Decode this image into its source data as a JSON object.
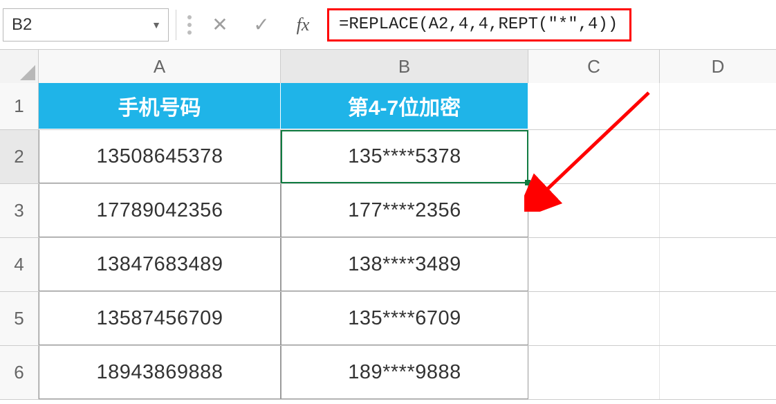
{
  "name_box": {
    "value": "B2"
  },
  "formula_bar": {
    "cancel_icon": "✕",
    "accept_icon": "✓",
    "fx_label": "fx",
    "formula": "=REPLACE(A2,4,4,REPT(\"*\",4))"
  },
  "columns": {
    "A": "A",
    "B": "B",
    "C": "C",
    "D": "D"
  },
  "rows": {
    "1": "1",
    "2": "2",
    "3": "3",
    "4": "4",
    "5": "5",
    "6": "6"
  },
  "headers": {
    "colA": "手机号码",
    "colB": "第4-7位加密"
  },
  "data": [
    {
      "phone": "13508645378",
      "masked": "135****5378"
    },
    {
      "phone": "17789042356",
      "masked": "177****2356"
    },
    {
      "phone": "13847683489",
      "masked": "138****3489"
    },
    {
      "phone": "13587456709",
      "masked": "135****6709"
    },
    {
      "phone": "18943869888",
      "masked": "189****9888"
    }
  ],
  "annotation_arrow_color": "#ff0000"
}
